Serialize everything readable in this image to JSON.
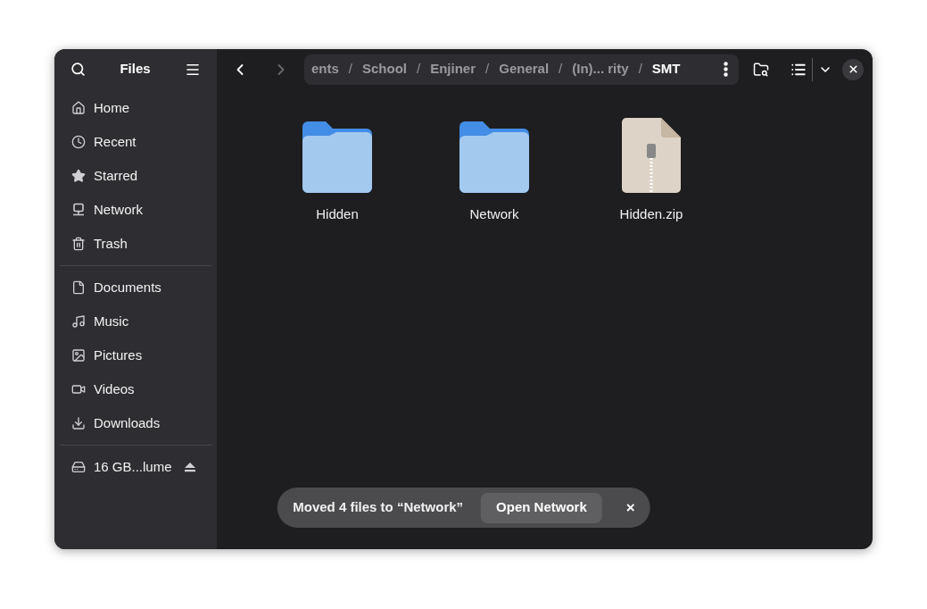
{
  "sidebar": {
    "title": "Files",
    "groups": [
      [
        {
          "kind": "home",
          "label": "Home",
          "selected": false
        },
        {
          "kind": "recent",
          "label": "Recent",
          "selected": false
        },
        {
          "kind": "starred",
          "label": "Starred",
          "selected": false
        },
        {
          "kind": "network",
          "label": "Network",
          "selected": false
        },
        {
          "kind": "trash",
          "label": "Trash",
          "selected": false
        }
      ],
      [
        {
          "kind": "documents",
          "label": "Documents",
          "selected": false
        },
        {
          "kind": "music",
          "label": "Music",
          "selected": false
        },
        {
          "kind": "pictures",
          "label": "Pictures",
          "selected": false
        },
        {
          "kind": "videos",
          "label": "Videos",
          "selected": false
        },
        {
          "kind": "downloads",
          "label": "Downloads",
          "selected": false
        }
      ],
      [
        {
          "kind": "drive",
          "label": "16 GB...lume",
          "selected": false,
          "eject": true
        }
      ]
    ]
  },
  "toolbar": {
    "back_disabled": false,
    "forward_disabled": true,
    "path": [
      {
        "kind": "segment",
        "label": "ents",
        "selected": false
      },
      {
        "kind": "separator",
        "label": "/"
      },
      {
        "kind": "segment",
        "label": "School",
        "selected": false
      },
      {
        "kind": "separator",
        "label": "/"
      },
      {
        "kind": "segment",
        "label": "Enjiner",
        "selected": false
      },
      {
        "kind": "separator",
        "label": "/"
      },
      {
        "kind": "segment",
        "label": "General",
        "selected": false
      },
      {
        "kind": "separator",
        "label": "/"
      },
      {
        "kind": "segment",
        "label": "(In)... rity",
        "selected": false
      },
      {
        "kind": "separator",
        "label": "/"
      },
      {
        "kind": "segment",
        "label": "SMT",
        "selected": true
      }
    ]
  },
  "files": [
    {
      "kind": "folder",
      "name": "Hidden"
    },
    {
      "kind": "folder",
      "name": "Network"
    },
    {
      "kind": "archive",
      "name": "Hidden.zip"
    }
  ],
  "toast": {
    "message": "Moved 4 files to “Network”",
    "action": "Open Network",
    "close": "×"
  }
}
